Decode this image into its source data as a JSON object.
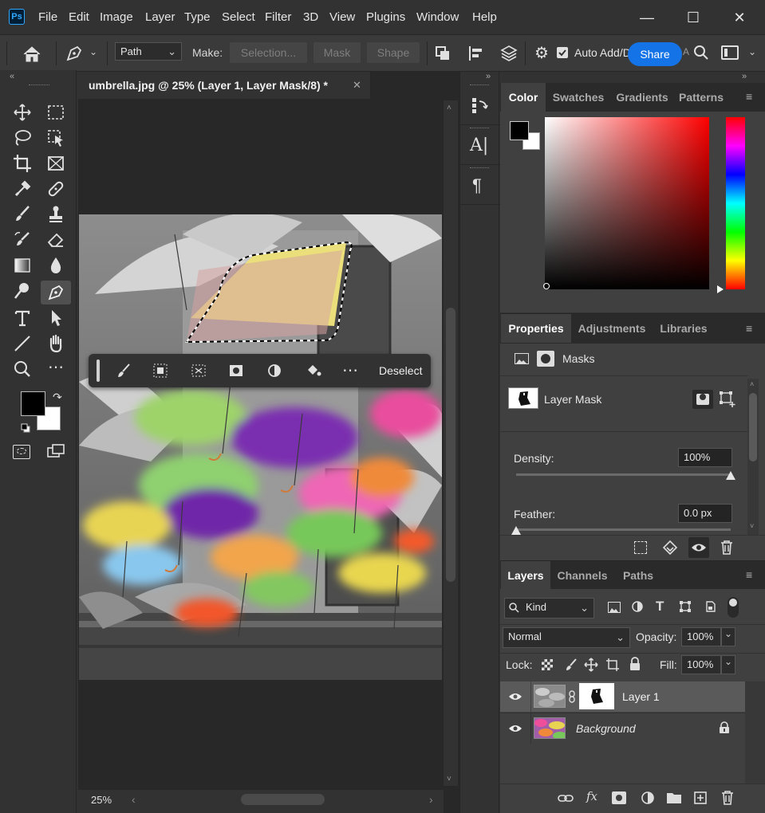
{
  "app": {
    "logo_text": "Ps"
  },
  "menu": [
    "File",
    "Edit",
    "Image",
    "Layer",
    "Type",
    "Select",
    "Filter",
    "3D",
    "View",
    "Plugins",
    "Window",
    "Help"
  ],
  "options_bar": {
    "path_mode": "Path",
    "make_label": "Make:",
    "selection_btn": "Selection...",
    "mask_btn": "Mask",
    "shape_btn": "Shape",
    "auto_add_label": "Auto Add/D",
    "auto_add_checked": true,
    "share_label": "Share"
  },
  "document": {
    "tab_title": "umbrella.jpg @ 25% (Layer 1, Layer Mask/8) *",
    "zoom": "25%"
  },
  "context_bar": {
    "deselect_label": "Deselect"
  },
  "color_panel": {
    "tabs": [
      "Color",
      "Swatches",
      "Gradients",
      "Patterns"
    ],
    "active_tab": "Color",
    "foreground": "#000000",
    "background": "#ffffff"
  },
  "properties_panel": {
    "tabs": [
      "Properties",
      "Adjustments",
      "Libraries"
    ],
    "active_tab": "Properties",
    "section_label": "Masks",
    "mask_label": "Layer Mask",
    "density_label": "Density:",
    "density_value": "100%",
    "density_fraction": 1.0,
    "feather_label": "Feather:",
    "feather_value": "0.0 px",
    "feather_fraction": 0.0
  },
  "layers_panel": {
    "tabs": [
      "Layers",
      "Channels",
      "Paths"
    ],
    "active_tab": "Layers",
    "kind_filter": "Kind",
    "blend_mode": "Normal",
    "opacity_label": "Opacity:",
    "opacity_value": "100%",
    "lock_label": "Lock:",
    "fill_label": "Fill:",
    "fill_value": "100%",
    "layers": [
      {
        "name": "Layer 1",
        "selected": true
      },
      {
        "name": "Background",
        "selected": false
      }
    ]
  },
  "colors": {
    "accent": "#1473e6",
    "panel": "#323232",
    "dark": "#282828"
  }
}
